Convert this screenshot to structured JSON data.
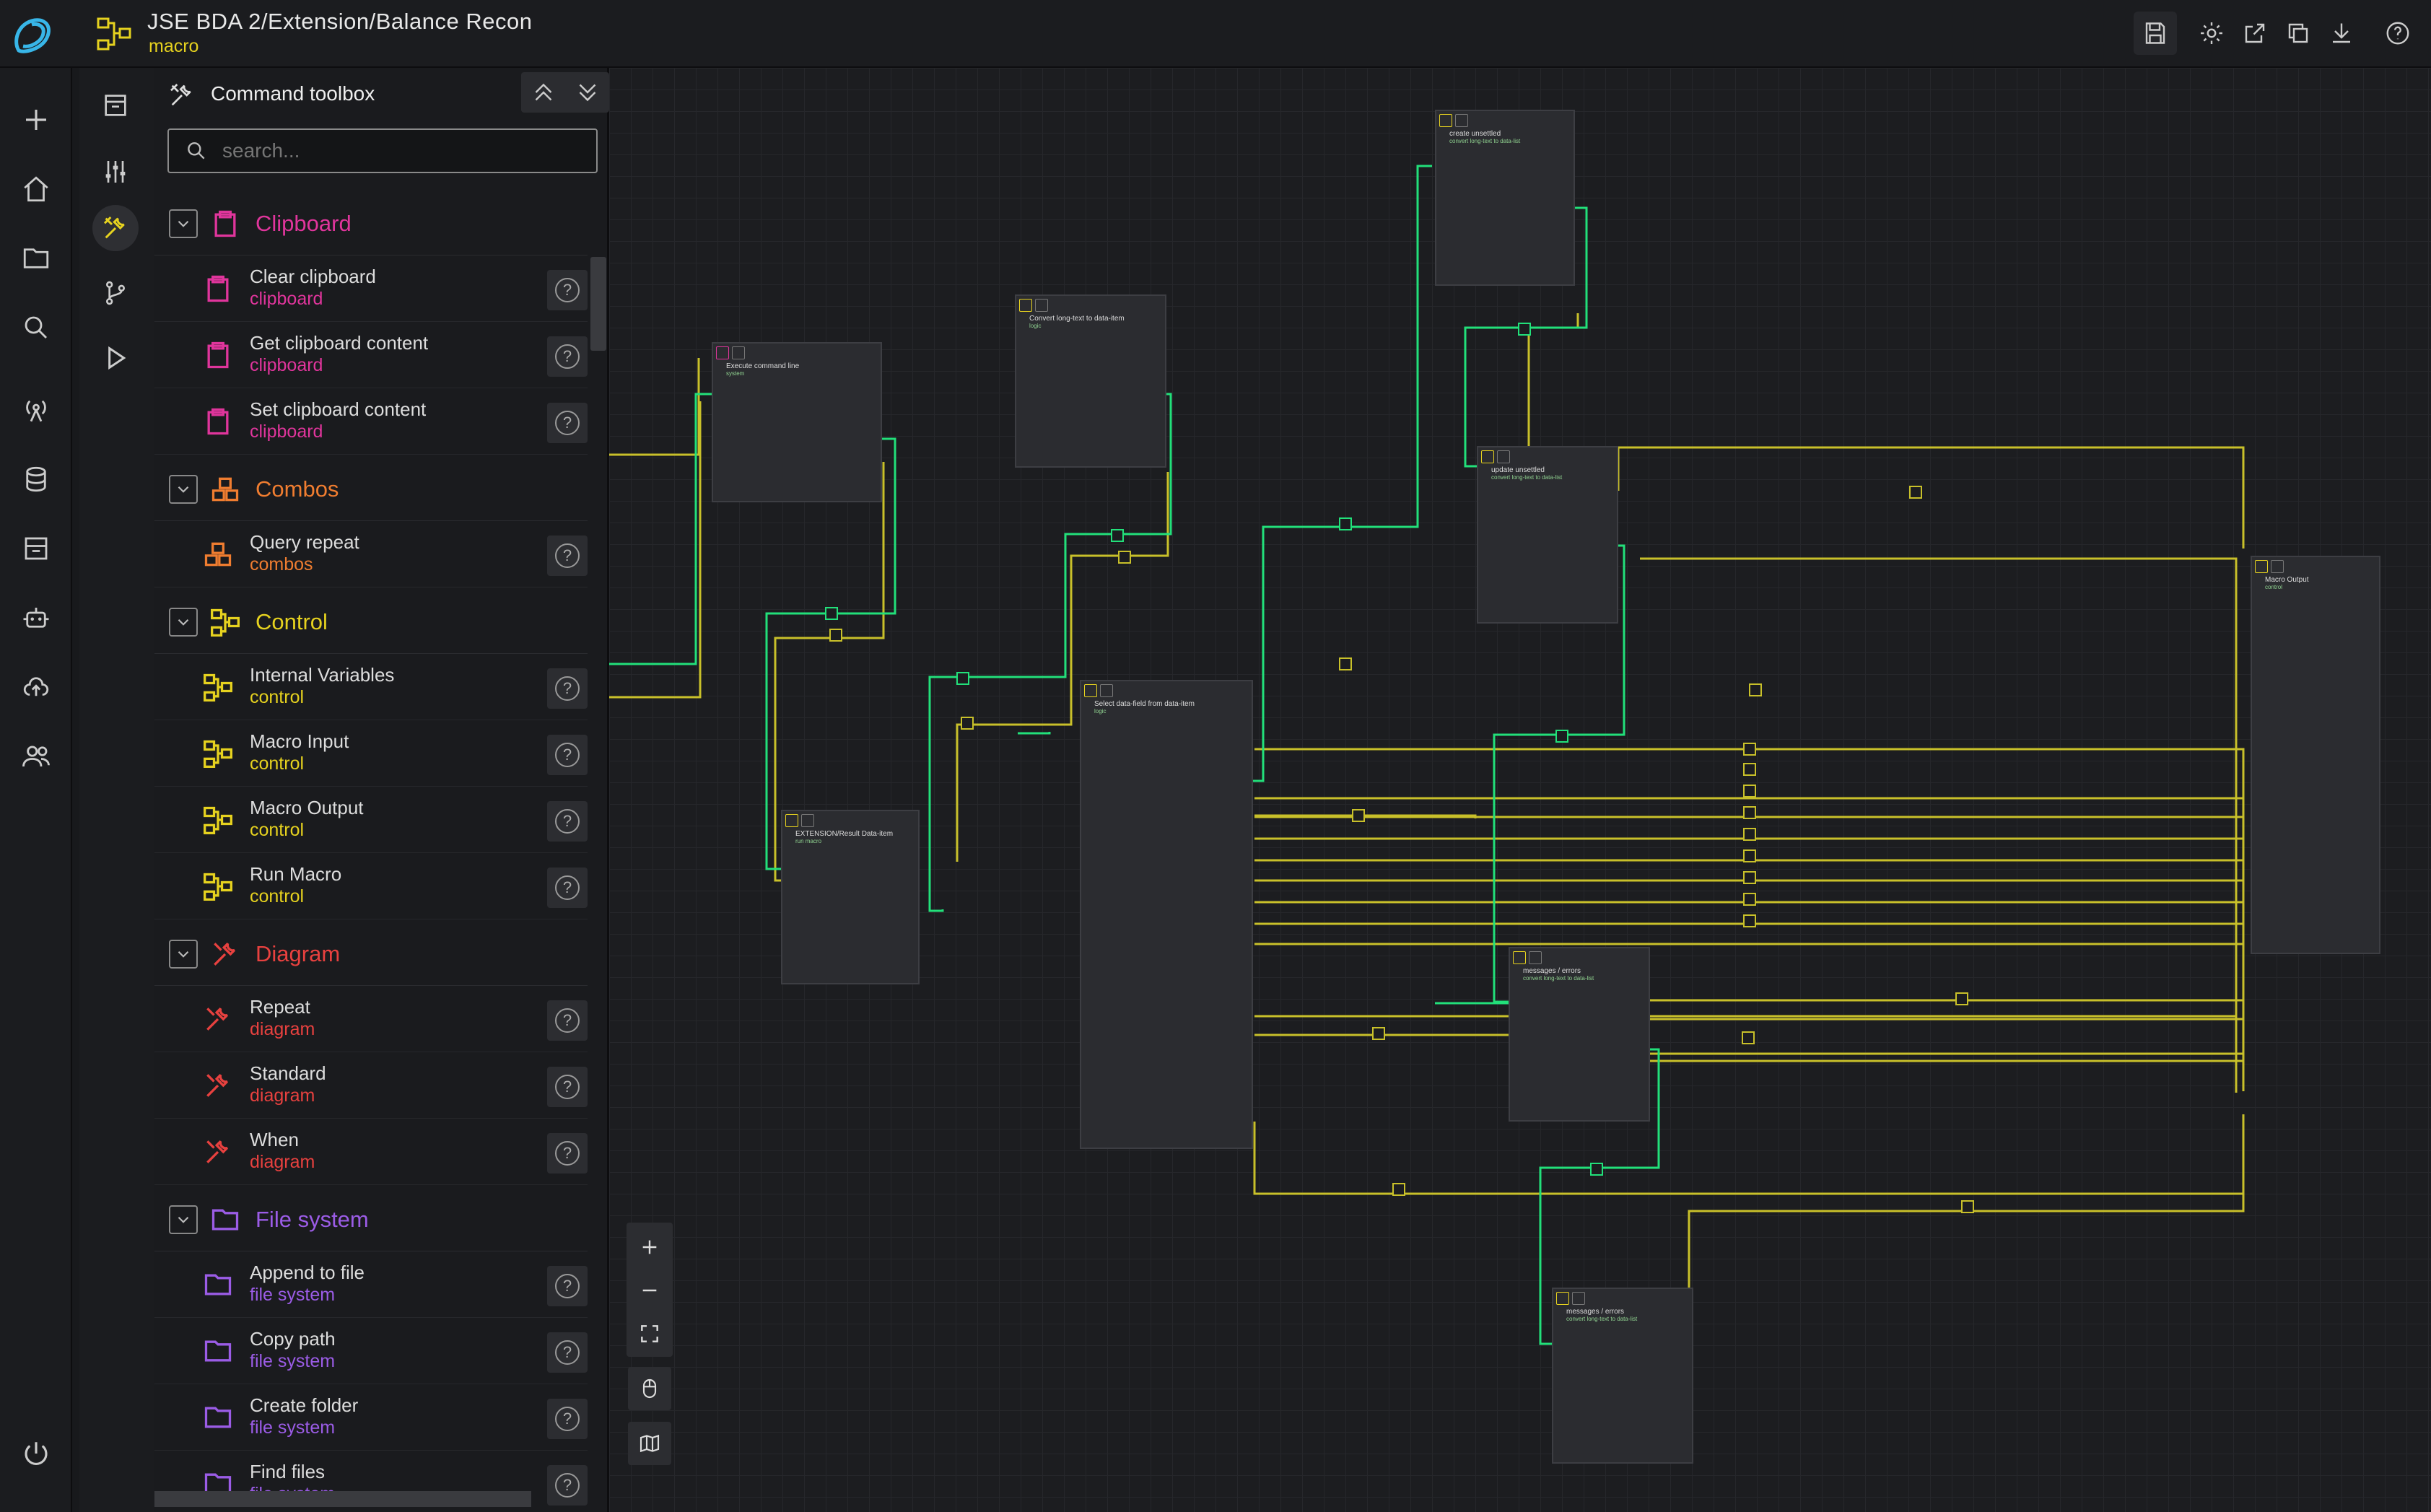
{
  "header": {
    "title": "JSE BDA 2/Extension/Balance Recon",
    "subtitle": "macro",
    "actions": [
      "save-icon",
      "settings-icon",
      "export-icon",
      "duplicate-icon",
      "download-icon",
      "help-icon"
    ]
  },
  "toolbox": {
    "title": "Command toolbox",
    "search_placeholder": "search...",
    "categories": [
      {
        "label": "Clipboard",
        "color": "#e0359c",
        "items": [
          {
            "name": "Clear clipboard",
            "category": "clipboard"
          },
          {
            "name": "Get clipboard content",
            "category": "clipboard"
          },
          {
            "name": "Set clipboard content",
            "category": "clipboard"
          }
        ]
      },
      {
        "label": "Combos",
        "color": "#f07d30",
        "items": [
          {
            "name": "Query repeat",
            "category": "combos"
          }
        ]
      },
      {
        "label": "Control",
        "color": "#e6d21f",
        "items": [
          {
            "name": "Internal Variables",
            "category": "control"
          },
          {
            "name": "Macro Input",
            "category": "control"
          },
          {
            "name": "Macro Output",
            "category": "control"
          },
          {
            "name": "Run Macro",
            "category": "control"
          }
        ]
      },
      {
        "label": "Diagram",
        "color": "#e8413f",
        "items": [
          {
            "name": "Repeat",
            "category": "diagram"
          },
          {
            "name": "Standard",
            "category": "diagram"
          },
          {
            "name": "When",
            "category": "diagram"
          }
        ]
      },
      {
        "label": "File system",
        "color": "#9b5ce6",
        "items": [
          {
            "name": "Append to file",
            "category": "file system"
          },
          {
            "name": "Copy path",
            "category": "file system"
          },
          {
            "name": "Create folder",
            "category": "file system"
          },
          {
            "name": "Find files",
            "category": "file system"
          }
        ]
      }
    ]
  },
  "canvas": {
    "nodes": [
      {
        "id": "n1",
        "title": "Execute command line",
        "sub": "system"
      },
      {
        "id": "n2",
        "title": "Convert long-text to data-item",
        "sub": "logic"
      },
      {
        "id": "n3",
        "title": "create unsettled",
        "sub": "convert long-text to data-list"
      },
      {
        "id": "n4",
        "title": "update unsettled",
        "sub": "convert long-text to data-list"
      },
      {
        "id": "n5",
        "title": "Select data-field from data-item",
        "sub": "logic"
      },
      {
        "id": "n6",
        "title": "EXTENSION/Result Data-item",
        "sub": "run macro"
      },
      {
        "id": "n7",
        "title": "messages / errors",
        "sub": "convert long-text to data-list"
      },
      {
        "id": "n8",
        "title": "messages / errors",
        "sub": "convert long-text to data-list"
      },
      {
        "id": "n9",
        "title": "Macro Output",
        "sub": "control"
      }
    ]
  },
  "colors": {
    "accent": "#e6d21f",
    "wire_active": "#22e07a",
    "wire_idle": "#c8c02a",
    "node_bg": "#2b2c30"
  }
}
